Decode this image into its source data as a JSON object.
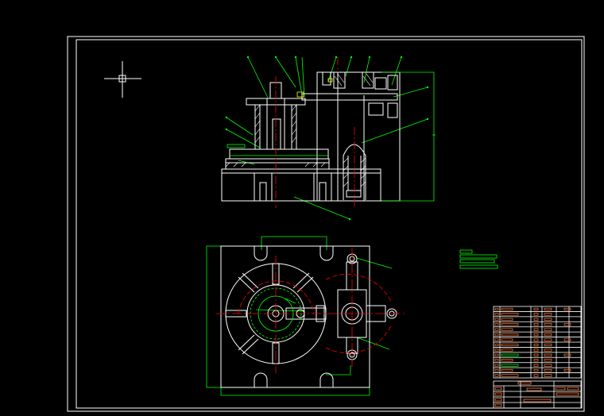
{
  "drawing": {
    "background": "#000000",
    "colors": {
      "outline": "#ffffff",
      "dimension": "#00ff00",
      "centerline": "#ff0000",
      "text": "#ffff00",
      "title_accent": "#ff8040"
    },
    "cursor": "crosshair-cursor-icon",
    "views": [
      "front-section-view",
      "top-plan-view"
    ],
    "title_block_rows": 14
  }
}
